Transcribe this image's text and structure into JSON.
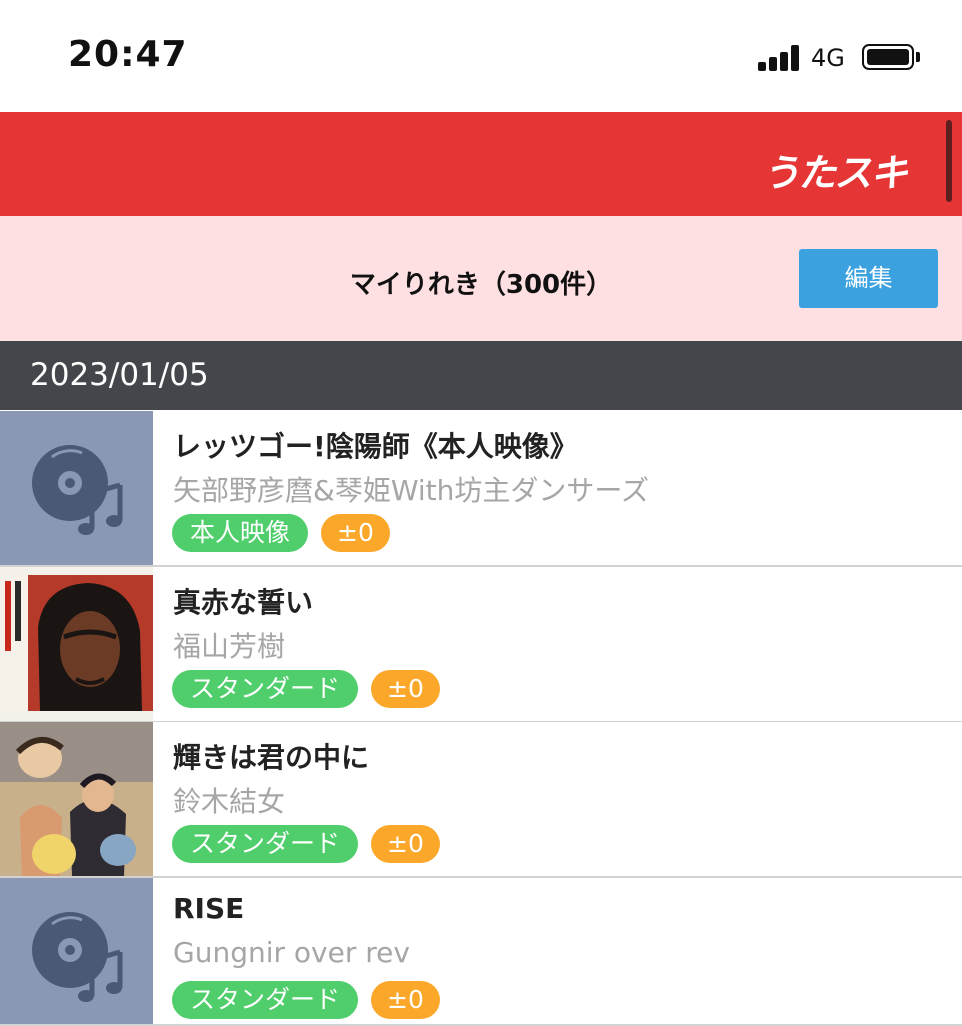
{
  "status_bar": {
    "time": "20:47",
    "network": "4G"
  },
  "header": {
    "brand": "うたスキ",
    "brand_color": "#e63535"
  },
  "history": {
    "title": "マイりれき（300件）",
    "edit_label": "編集"
  },
  "date_group": {
    "date": "2023/01/05"
  },
  "songs": [
    {
      "title": "レッツゴー!陰陽師《本人映像》",
      "artist": "矢部野彦麿&琴姫With坊主ダンサーズ",
      "type_tag": "本人映像",
      "key_tag": "±0",
      "thumbnail": "disc-music-icon"
    },
    {
      "title": "真赤な誓い",
      "artist": "福山芳樹",
      "type_tag": "スタンダード",
      "key_tag": "±0",
      "thumbnail": "album-art"
    },
    {
      "title": "輝きは君の中に",
      "artist": "鈴木結女",
      "type_tag": "スタンダード",
      "key_tag": "±0",
      "thumbnail": "album-art"
    },
    {
      "title": "RISE",
      "artist": "Gungnir over rev",
      "type_tag": "スタンダード",
      "key_tag": "±0",
      "thumbnail": "disc-music-icon"
    }
  ]
}
